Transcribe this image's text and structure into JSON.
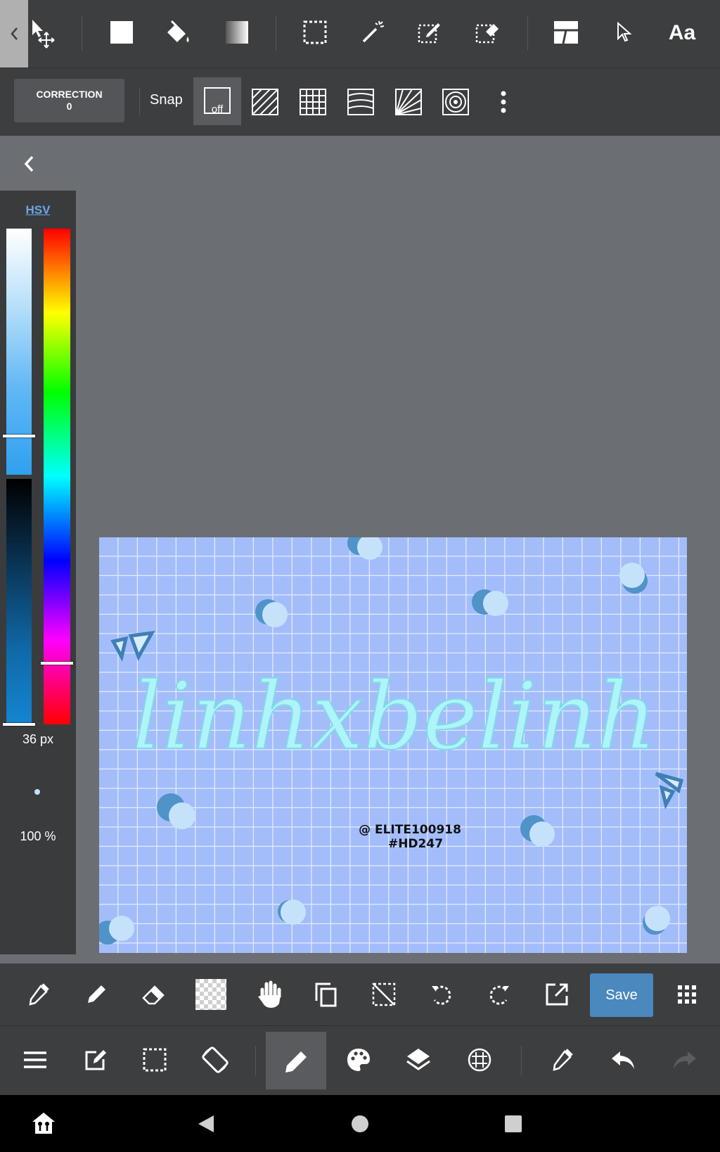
{
  "snap_toolbar": {
    "correction_label": "CORRECTION",
    "correction_value": "0",
    "snap_label": "Snap",
    "snap_off_label": "off"
  },
  "color_panel": {
    "mode_label": "HSV",
    "brush_size": "36 px",
    "opacity": "100 %",
    "current_color": "#c4e4fb"
  },
  "canvas": {
    "text_main": "linhxbelinh",
    "credit_line1": "@ ELITE100918",
    "credit_line2": "#HD247"
  },
  "bottom_toolbar": {
    "save_label": "Save"
  },
  "top_toolbar": {
    "text_tool_label": "Aa"
  },
  "colors": {
    "toolbar_bg": "#3d3e40",
    "canvas_bg": "#6b6e72",
    "save_button": "#4a88be",
    "artwork_bg": "#a3bdfb",
    "lettering": "#aef4f8"
  }
}
